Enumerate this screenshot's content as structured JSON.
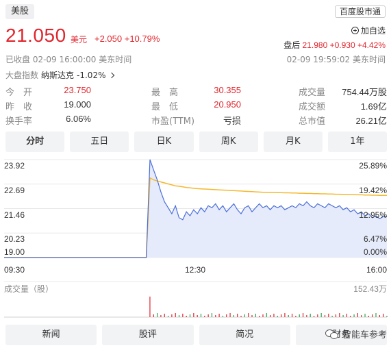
{
  "header": {
    "market_tag": "美股",
    "source_tag": "百度股市通"
  },
  "quote": {
    "price": "21.050",
    "currency": "美元",
    "change": "+2.050 +10.79%",
    "watch_label": "加自选",
    "afterhours_label": "盘后",
    "afterhours_value": "21.980 +0.930 +4.42%",
    "status_left": "已收盘  02-09 16:00:00  美东时间",
    "status_right": "02-09 19:59:02  美东时间",
    "index_label": "大盘指数",
    "index_name": "纳斯达克",
    "index_change": "-1.02%"
  },
  "stats": [
    [
      {
        "k": "今　开",
        "v": "23.750",
        "color": "red"
      },
      {
        "k": "最　高",
        "v": "30.355",
        "color": "red"
      },
      {
        "k": "成交量",
        "v": "754.44万股",
        "color": "dark"
      }
    ],
    [
      {
        "k": "昨　收",
        "v": "19.000",
        "color": "dark"
      },
      {
        "k": "最　低",
        "v": "20.950",
        "color": "red"
      },
      {
        "k": "成交额",
        "v": "1.69亿",
        "color": "dark"
      }
    ],
    [
      {
        "k": "换手率",
        "v": "6.06%",
        "color": "dark"
      },
      {
        "k": "市盈(TTM)",
        "v": "亏损",
        "color": "dark"
      },
      {
        "k": "总市值",
        "v": "26.21亿",
        "color": "dark"
      }
    ]
  ],
  "tabs": [
    "分时",
    "五日",
    "日K",
    "周K",
    "月K",
    "1年"
  ],
  "active_tab": 0,
  "chart_data": {
    "type": "line",
    "y_price_ticks": [
      "23.92",
      "22.69",
      "21.46",
      "20.23",
      "19.00"
    ],
    "y_pct_ticks": [
      "25.89%",
      "19.42%",
      "12.95%",
      "6.47%",
      "0.00%"
    ],
    "x_ticks": [
      "09:30",
      "12:30",
      "16:00"
    ],
    "ylim": [
      19.0,
      23.92
    ],
    "prev_close": 19.0,
    "volume_label": "成交量（股）",
    "volume_max_label": "152.43万",
    "series": [
      {
        "values": [
          19.0,
          19.0,
          19.0,
          19.0,
          19.0,
          19.0,
          19.0,
          19.0,
          19.0,
          19.0,
          19.0,
          19.0,
          19.0,
          19.0,
          19.0,
          19.0,
          19.0,
          19.0,
          19.0,
          19.0,
          19.0,
          19.0,
          19.0,
          19.0,
          19.0,
          19.0,
          19.0,
          19.0,
          19.0,
          19.0,
          19.0,
          19.0,
          19.0,
          19.0,
          19.0,
          19.0,
          19.0,
          19.0,
          19.0,
          19.0,
          23.92,
          23.4,
          22.9,
          22.3,
          21.8,
          21.5,
          21.2,
          21.6,
          21.0,
          20.9,
          21.3,
          21.1,
          21.4,
          21.2,
          21.5,
          21.3,
          21.6,
          21.5,
          21.7,
          21.4,
          21.6,
          21.3,
          21.5,
          21.7,
          21.4,
          21.2,
          21.5,
          21.6,
          21.3,
          21.5,
          21.7,
          21.5,
          21.6,
          21.4,
          21.6,
          21.5,
          21.6,
          21.4,
          21.5,
          21.6,
          21.5,
          21.7,
          21.6,
          21.8,
          21.6,
          21.5,
          21.7,
          21.6,
          21.5,
          21.7,
          21.6,
          21.5,
          21.6,
          21.4,
          21.5,
          21.3,
          21.4,
          21.2,
          21.3,
          21.1,
          21.2,
          21.0,
          21.1,
          20.95,
          21.05,
          21.05
        ]
      },
      {
        "values": [
          19.0,
          19.0,
          19.0,
          19.0,
          19.0,
          19.0,
          19.0,
          19.0,
          19.0,
          19.0,
          19.0,
          19.0,
          19.0,
          19.0,
          19.0,
          19.0,
          19.0,
          19.0,
          19.0,
          19.0,
          19.0,
          19.0,
          19.0,
          19.0,
          19.0,
          19.0,
          19.0,
          19.0,
          19.0,
          19.0,
          19.0,
          19.0,
          19.0,
          19.0,
          19.0,
          19.0,
          19.0,
          19.0,
          19.0,
          19.0,
          23.0,
          22.9,
          22.85,
          22.8,
          22.75,
          22.7,
          22.65,
          22.6,
          22.58,
          22.55,
          22.52,
          22.5,
          22.48,
          22.46,
          22.45,
          22.44,
          22.43,
          22.42,
          22.41,
          22.4,
          22.39,
          22.38,
          22.37,
          22.36,
          22.35,
          22.34,
          22.33,
          22.32,
          22.31,
          22.3,
          22.29,
          22.28,
          22.28,
          22.27,
          22.27,
          22.26,
          22.26,
          22.25,
          22.25,
          22.24,
          22.24,
          22.23,
          22.23,
          22.22,
          22.22,
          22.21,
          22.21,
          22.2,
          22.2,
          22.19,
          22.19,
          22.18,
          22.18,
          22.17,
          22.17,
          22.16,
          22.16,
          22.15,
          22.15,
          22.14,
          22.14,
          22.13,
          22.13,
          22.12,
          22.12,
          22.12
        ]
      }
    ]
  },
  "bottom_nav": [
    "新闻",
    "股评",
    "简况",
    "财务"
  ],
  "watermark": "智能车参考",
  "colors": {
    "up": "#e1252d",
    "price_line": "#4a6fd9",
    "avg_line": "#f5b82e",
    "fill": "#e6ebfb",
    "grid": "#e8e8e8"
  }
}
